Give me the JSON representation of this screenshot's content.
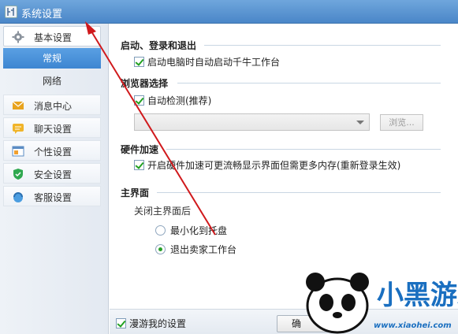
{
  "window": {
    "title": "系统设置"
  },
  "sidebar": {
    "items": [
      {
        "label": "基本设置",
        "icon": "gear-icon"
      },
      {
        "label": "消息中心",
        "icon": "envelope-icon"
      },
      {
        "label": "聊天设置",
        "icon": "chat-bubble-icon"
      },
      {
        "label": "个性设置",
        "icon": "window-icon"
      },
      {
        "label": "安全设置",
        "icon": "shield-icon"
      },
      {
        "label": "客服设置",
        "icon": "headset-icon"
      }
    ],
    "subitems": [
      {
        "label": "常规",
        "selected": true
      },
      {
        "label": "网络",
        "selected": false
      }
    ]
  },
  "sections": {
    "startup": {
      "title": "启动、登录和退出",
      "autostart_label": "启动电脑时自动启动千牛工作台",
      "autostart_checked": true
    },
    "browser": {
      "title": "浏览器选择",
      "autodetect_label": "自动检测(推荐)",
      "autodetect_checked": true,
      "browse_label": "浏览..."
    },
    "hardware": {
      "title": "硬件加速",
      "accel_label": "开启硬件加速可更流畅显示界面但需更多内存(重新登录生效)",
      "accel_checked": true
    },
    "main_ui": {
      "title": "主界面",
      "close_prompt": "关闭主界面后",
      "options": [
        {
          "label": "最小化到托盘",
          "selected": false
        },
        {
          "label": "退出卖家工作台",
          "selected": true
        }
      ]
    }
  },
  "footer": {
    "roaming_label": "漫游我的设置",
    "roaming_checked": true,
    "ok_label": "确"
  },
  "watermark": {
    "brand": "小黑游戏",
    "url": "www.xiaohei.com"
  },
  "colors": {
    "titlebar": "#4a86c8",
    "selected": "#3d86d1",
    "check": "#21a121",
    "annotation_arrow": "#d0191c"
  }
}
